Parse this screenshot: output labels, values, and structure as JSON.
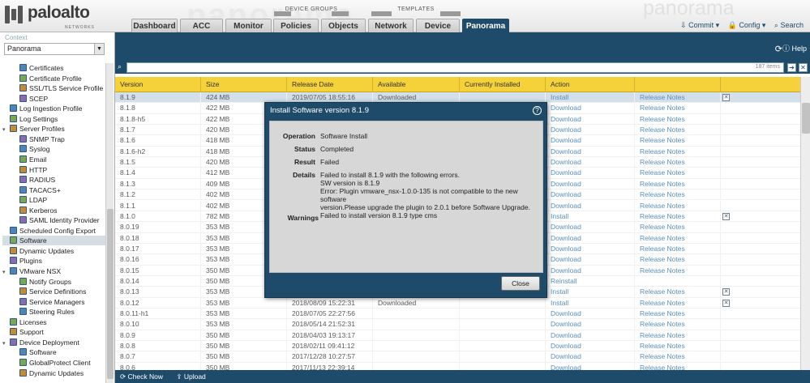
{
  "header": {
    "logo_word": "paloalto",
    "logo_sub": "NETWORKS",
    "background_word": "panorama",
    "groups": [
      "DEVICE GROUPS",
      "TEMPLATES"
    ],
    "tabs": [
      "Dashboard",
      "ACC",
      "Monitor",
      "Policies",
      "Objects",
      "Network",
      "Device",
      "Panorama"
    ],
    "active_tab": "Panorama",
    "commit": "Commit",
    "config": "Config",
    "search": "Search"
  },
  "sidebar": {
    "context_label": "Context",
    "context_value": "Panorama",
    "tree": [
      {
        "label": "Certificates",
        "level": 2
      },
      {
        "label": "Certificate Profile",
        "level": 2
      },
      {
        "label": "SSL/TLS Service Profile",
        "level": 2
      },
      {
        "label": "SCEP",
        "level": 2
      },
      {
        "label": "Log Ingestion Profile",
        "level": 1
      },
      {
        "label": "Log Settings",
        "level": 1
      },
      {
        "label": "Server Profiles",
        "level": 1,
        "expanded": true
      },
      {
        "label": "SNMP Trap",
        "level": 2
      },
      {
        "label": "Syslog",
        "level": 2
      },
      {
        "label": "Email",
        "level": 2
      },
      {
        "label": "HTTP",
        "level": 2
      },
      {
        "label": "RADIUS",
        "level": 2
      },
      {
        "label": "TACACS+",
        "level": 2
      },
      {
        "label": "LDAP",
        "level": 2
      },
      {
        "label": "Kerberos",
        "level": 2
      },
      {
        "label": "SAML Identity Provider",
        "level": 2
      },
      {
        "label": "Scheduled Config Export",
        "level": 1
      },
      {
        "label": "Software",
        "level": 1,
        "selected": true
      },
      {
        "label": "Dynamic Updates",
        "level": 1
      },
      {
        "label": "Plugins",
        "level": 1
      },
      {
        "label": "VMware NSX",
        "level": 1,
        "expanded": true
      },
      {
        "label": "Notify Groups",
        "level": 2
      },
      {
        "label": "Service Definitions",
        "level": 2
      },
      {
        "label": "Service Managers",
        "level": 2
      },
      {
        "label": "Steering Rules",
        "level": 2
      },
      {
        "label": "Licenses",
        "level": 1
      },
      {
        "label": "Support",
        "level": 1
      },
      {
        "label": "Device Deployment",
        "level": 1,
        "expanded": true
      },
      {
        "label": "Software",
        "level": 2
      },
      {
        "label": "GlobalProtect Client",
        "level": 2
      },
      {
        "label": "Dynamic Updates",
        "level": 2
      }
    ]
  },
  "toolbar": {
    "help": "Help",
    "filter_count": "187 items"
  },
  "grid": {
    "columns": [
      "Version",
      "Size",
      "Release Date",
      "Available",
      "Currently Installed",
      "Action",
      ""
    ],
    "rows": [
      {
        "version": "8.1.9",
        "size": "424 MB",
        "date": "2019/07/05 18:55:16",
        "available": "Downloaded",
        "action": "Install",
        "notes": "Release Notes",
        "remove": true,
        "selected": true
      },
      {
        "version": "8.1.8",
        "size": "422 MB",
        "date": "",
        "available": "",
        "action": "Download",
        "notes": "Release Notes"
      },
      {
        "version": "8.1.8-h5",
        "size": "422 MB",
        "date": "",
        "available": "",
        "action": "Download",
        "notes": "Release Notes"
      },
      {
        "version": "8.1.7",
        "size": "420 MB",
        "date": "",
        "available": "",
        "action": "Download",
        "notes": "Release Notes"
      },
      {
        "version": "8.1.6",
        "size": "418 MB",
        "date": "",
        "available": "",
        "action": "Download",
        "notes": "Release Notes"
      },
      {
        "version": "8.1.6-h2",
        "size": "418 MB",
        "date": "",
        "available": "",
        "action": "Download",
        "notes": "Release Notes"
      },
      {
        "version": "8.1.5",
        "size": "420 MB",
        "date": "",
        "available": "",
        "action": "Download",
        "notes": "Release Notes"
      },
      {
        "version": "8.1.4",
        "size": "412 MB",
        "date": "",
        "available": "",
        "action": "Download",
        "notes": "Release Notes"
      },
      {
        "version": "8.1.3",
        "size": "409 MB",
        "date": "",
        "available": "",
        "action": "Download",
        "notes": "Release Notes"
      },
      {
        "version": "8.1.2",
        "size": "402 MB",
        "date": "",
        "available": "",
        "action": "Download",
        "notes": "Release Notes"
      },
      {
        "version": "8.1.1",
        "size": "402 MB",
        "date": "",
        "available": "",
        "action": "Download",
        "notes": "Release Notes"
      },
      {
        "version": "8.1.0",
        "size": "782 MB",
        "date": "",
        "available": "",
        "action": "Install",
        "notes": "Release Notes",
        "remove": true
      },
      {
        "version": "8.0.19",
        "size": "353 MB",
        "date": "",
        "available": "",
        "action": "Download",
        "notes": "Release Notes"
      },
      {
        "version": "8.0.18",
        "size": "353 MB",
        "date": "",
        "available": "",
        "action": "Download",
        "notes": "Release Notes"
      },
      {
        "version": "8.0.17",
        "size": "353 MB",
        "date": "",
        "available": "",
        "action": "Download",
        "notes": "Release Notes"
      },
      {
        "version": "8.0.16",
        "size": "353 MB",
        "date": "",
        "available": "",
        "action": "Download",
        "notes": "Release Notes"
      },
      {
        "version": "8.0.15",
        "size": "350 MB",
        "date": "",
        "available": "",
        "action": "Download",
        "notes": "Release Notes"
      },
      {
        "version": "8.0.14",
        "size": "350 MB",
        "date": "",
        "available": "",
        "action": "Reinstall",
        "notes": ""
      },
      {
        "version": "8.0.13",
        "size": "353 MB",
        "date": "2018/08/09 15:22:31",
        "available": "",
        "action": "Install",
        "notes": "Release Notes",
        "remove": true
      },
      {
        "version": "8.0.12",
        "size": "353 MB",
        "date": "2018/08/09 15:22:31",
        "available": "Downloaded",
        "action": "Install",
        "notes": "Release Notes",
        "remove": true
      },
      {
        "version": "8.0.11-h1",
        "size": "353 MB",
        "date": "2018/07/05 22:27:56",
        "available": "",
        "action": "Download",
        "notes": "Release Notes"
      },
      {
        "version": "8.0.10",
        "size": "353 MB",
        "date": "2018/05/14 21:52:31",
        "available": "",
        "action": "Download",
        "notes": "Release Notes"
      },
      {
        "version": "8.0.9",
        "size": "350 MB",
        "date": "2018/04/03 19:13:17",
        "available": "",
        "action": "Download",
        "notes": "Release Notes"
      },
      {
        "version": "8.0.8",
        "size": "350 MB",
        "date": "2018/02/11 09:41:12",
        "available": "",
        "action": "Download",
        "notes": "Release Notes"
      },
      {
        "version": "8.0.7",
        "size": "350 MB",
        "date": "2017/12/28 10:27:57",
        "available": "",
        "action": "Download",
        "notes": "Release Notes"
      },
      {
        "version": "8.0.6",
        "size": "350 MB",
        "date": "2017/11/13 22:39:14",
        "available": "",
        "action": "Download",
        "notes": "Release Notes"
      }
    ]
  },
  "bottombar": {
    "check_now": "Check Now",
    "upload": "Upload"
  },
  "dialog": {
    "title": "Install Software version 8.1.9",
    "operation_label": "Operation",
    "operation": "Software Install",
    "status_label": "Status",
    "status": "Completed",
    "result_label": "Result",
    "result": "Failed",
    "details_label": "Details",
    "details": [
      "Failed to install 8.1.9 with the following errors.",
      "SW version is 8.1.9",
      "Error: Plugin vmware_nsx-1.0.0-135 is not compatible to the new software",
      "version.Please upgrade the plugin to 2.0.1 before Software Upgrade.",
      "Failed to install version 8.1.9 type cms"
    ],
    "warnings_label": "Warnings",
    "close": "Close"
  },
  "colors": {
    "nav": "#1f4b6b",
    "header_row": "#f5d13a",
    "link": "#1f69a6"
  }
}
